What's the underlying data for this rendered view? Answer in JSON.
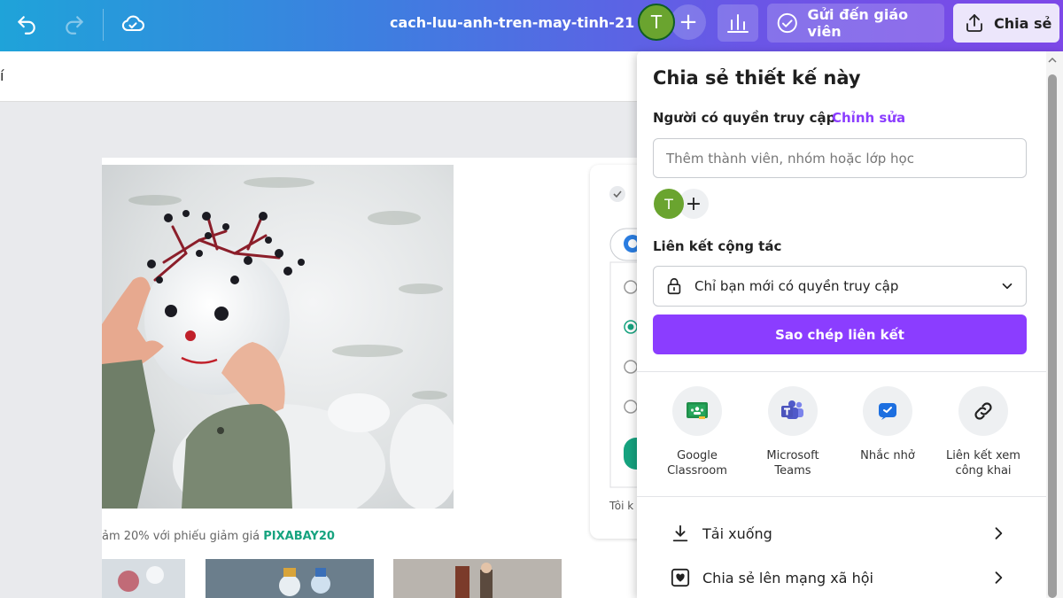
{
  "topbar": {
    "doc_title": "cach-luu-anh-tren-may-tinh-21",
    "avatar_initial": "T",
    "send_label": "Gửi đến giáo viên",
    "share_label": "Chia sẻ"
  },
  "subbar": {
    "partial_text": "í"
  },
  "canvas": {
    "promo_prefix": "ảm 20% với phiếu giảm giá ",
    "promo_code": "PIXABAY20",
    "side_partial_text": "Tôi k"
  },
  "panel": {
    "title": "Chia sẻ thiết kế này",
    "access_label": "Người có quyền truy cập",
    "edit_link": "Chỉnh sửa",
    "member_placeholder": "Thêm thành viên, nhóm hoặc lớp học",
    "member_initial": "T",
    "collab_label": "Liên kết cộng tác",
    "access_value": "Chỉ bạn mới có quyền truy cập",
    "copy_label": "Sao chép liên kết",
    "share_options": [
      {
        "label_line1": "Google",
        "label_line2": "Classroom",
        "icon": "google-classroom-icon"
      },
      {
        "label_line1": "Microsoft",
        "label_line2": "Teams",
        "icon": "microsoft-teams-icon"
      },
      {
        "label_line1": "Nhắc nhở",
        "label_line2": "",
        "icon": "reminder-icon"
      },
      {
        "label_line1": "Liên kết xem",
        "label_line2": "công khai",
        "icon": "link-icon"
      }
    ],
    "download_label": "Tải xuống",
    "social_label": "Chia sẻ lên mạng xã hội"
  },
  "colors": {
    "accent_purple": "#8b3dff",
    "avatar_green": "#6aa42f",
    "promo_green": "#16a37f"
  }
}
